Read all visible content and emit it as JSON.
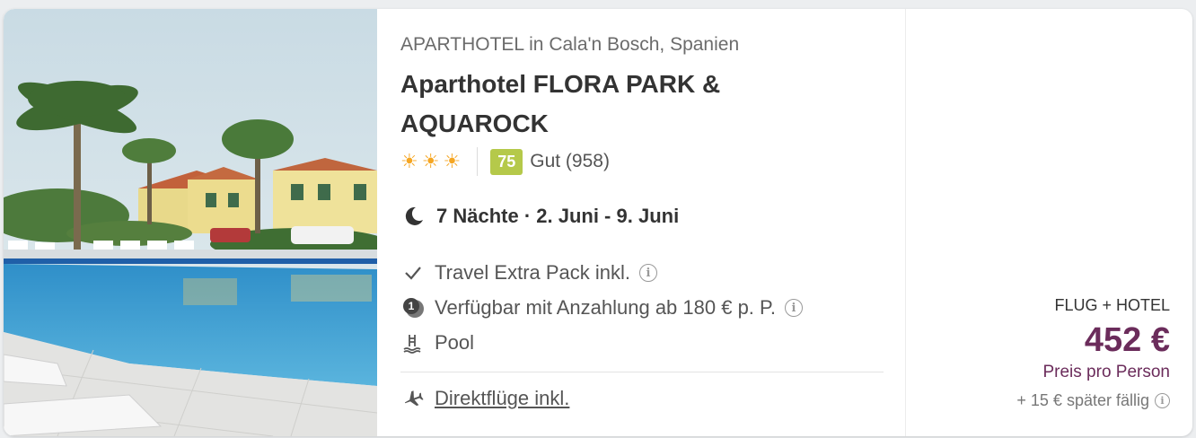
{
  "hotel": {
    "type_location": "APARTHOTEL in Cala'n Bosch, Spanien",
    "name": "Aparthotel FLORA PARK & AQUAROCK",
    "stars": 3,
    "star_icon": "sun-icon",
    "score": "75",
    "score_label": "Gut (958)",
    "score_color": "#b5c94a"
  },
  "stay": {
    "nights_text": "7 Nächte · 2. Juni - 9. Juni"
  },
  "features": [
    {
      "icon": "check-icon",
      "text": "Travel Extra Pack inkl.",
      "info": true
    },
    {
      "icon": "deposit-icon",
      "text": "Verfügbar mit Anzahlung ab 180 € p. P.",
      "info": true
    },
    {
      "icon": "pool-icon",
      "text": "Pool",
      "info": false
    }
  ],
  "flights": {
    "icon": "plane-icon",
    "text": "Direktflüge inkl."
  },
  "price": {
    "offer_type": "FLUG + HOTEL",
    "amount": "452 €",
    "per_person": "Preis pro Person",
    "later_fee": "+ 15 € später fällig",
    "price_color": "#6b2c5b"
  },
  "info_glyph": "i"
}
